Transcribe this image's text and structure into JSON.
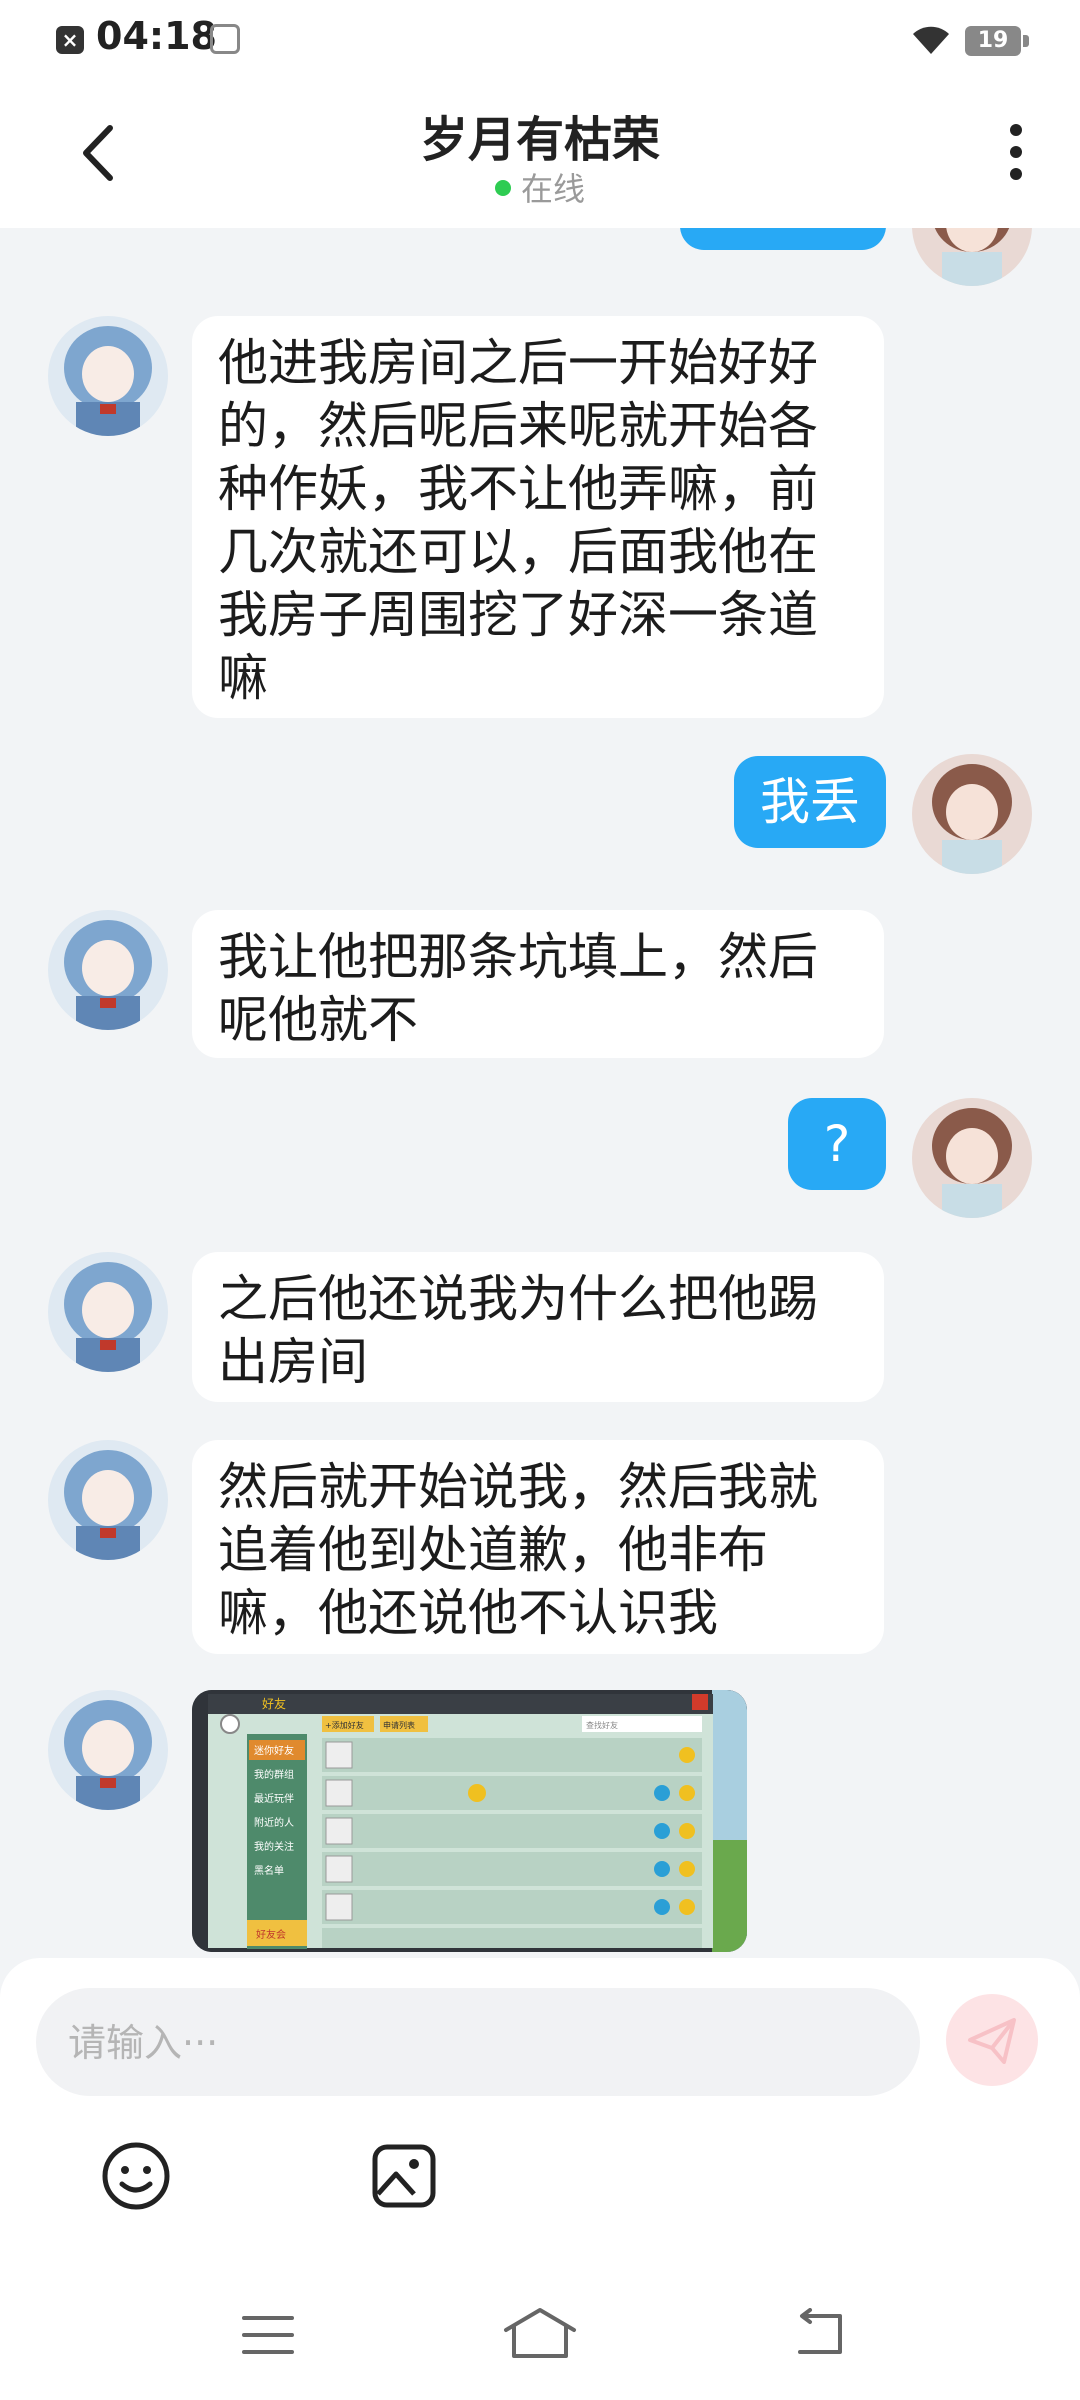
{
  "status_bar": {
    "time": "04:18",
    "battery": "19",
    "notification_icon": "close-icon"
  },
  "header": {
    "title": "岁月有枯荣",
    "status": "在线",
    "status_color": "#2ecc52"
  },
  "messages": [
    {
      "side": "left",
      "text": "他进我房间之后一开始好好的，然后呢后来呢就开始各种作妖，我不让他弄嘛，前几次就还可以，后面我他在我房子周围挖了好深一条道嘛"
    },
    {
      "side": "right",
      "text": "我丢"
    },
    {
      "side": "left",
      "text": "我让他把那条坑填上，然后呢他就不"
    },
    {
      "side": "right",
      "text": "?"
    },
    {
      "side": "left",
      "text": "之后他还说我为什么把他踢出房间"
    },
    {
      "side": "left",
      "text": "然后就开始说我，然后我就追着他到处道歉，他非布嘛，他还说他不认识我"
    },
    {
      "side": "left",
      "type": "image"
    }
  ],
  "screenshot_image": {
    "tab_title": "好友",
    "btn_add": "+添加好友",
    "btn_request": "申请列表",
    "search_placeholder": "查找好友",
    "menu": [
      "迷你好友",
      "我的群组",
      "最近玩伴",
      "附近的人",
      "我的关注",
      "黑名单"
    ],
    "badge": "好友会"
  },
  "input": {
    "placeholder": "请输入···"
  },
  "colors": {
    "accent": "#28a9f5",
    "send_button_bg": "#fde3e5"
  }
}
